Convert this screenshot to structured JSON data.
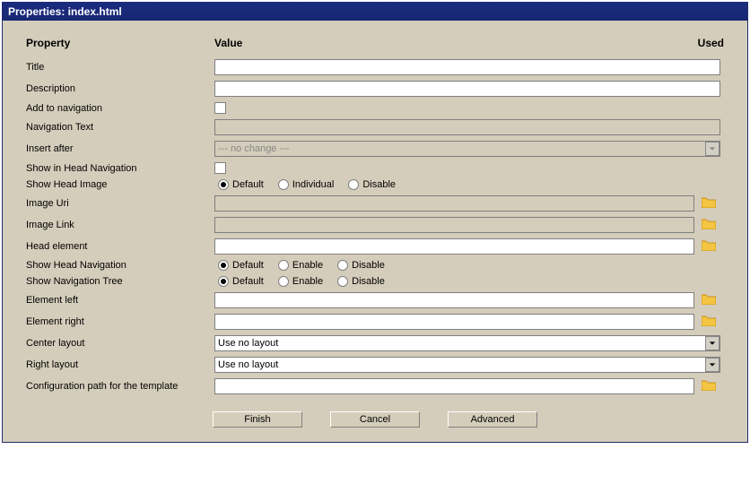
{
  "window": {
    "title": "Properties: index.html"
  },
  "headers": {
    "property": "Property",
    "value": "Value",
    "used": "Used"
  },
  "rows": {
    "title": {
      "label": "Title",
      "value": ""
    },
    "description": {
      "label": "Description",
      "value": ""
    },
    "add_nav": {
      "label": "Add to navigation",
      "checked": false
    },
    "nav_text": {
      "label": "Navigation Text",
      "value": "",
      "disabled": true
    },
    "insert_after": {
      "label": "Insert after",
      "value": "--- no change ---",
      "disabled": true
    },
    "show_head_nav_chk": {
      "label": "Show in Head Navigation",
      "checked": false
    },
    "show_head_image": {
      "label": "Show Head Image",
      "options": {
        "default": "Default",
        "individual": "Individual",
        "disable": "Disable"
      },
      "selected": "default"
    },
    "image_uri": {
      "label": "Image Uri",
      "value": ""
    },
    "image_link": {
      "label": "Image Link",
      "value": ""
    },
    "head_element": {
      "label": "Head element",
      "value": ""
    },
    "show_head_navigation": {
      "label": "Show Head Navigation",
      "options": {
        "default": "Default",
        "enable": "Enable",
        "disable": "Disable"
      },
      "selected": "default"
    },
    "show_nav_tree": {
      "label": "Show Navigation Tree",
      "options": {
        "default": "Default",
        "enable": "Enable",
        "disable": "Disable"
      },
      "selected": "default"
    },
    "element_left": {
      "label": "Element left",
      "value": ""
    },
    "element_right": {
      "label": "Element right",
      "value": ""
    },
    "center_layout": {
      "label": "Center layout",
      "value": "Use no layout"
    },
    "right_layout": {
      "label": "Right layout",
      "value": "Use no layout"
    },
    "config_path": {
      "label": "Configuration path for the template",
      "value": ""
    }
  },
  "buttons": {
    "finish": "Finish",
    "cancel": "Cancel",
    "advanced": "Advanced"
  }
}
